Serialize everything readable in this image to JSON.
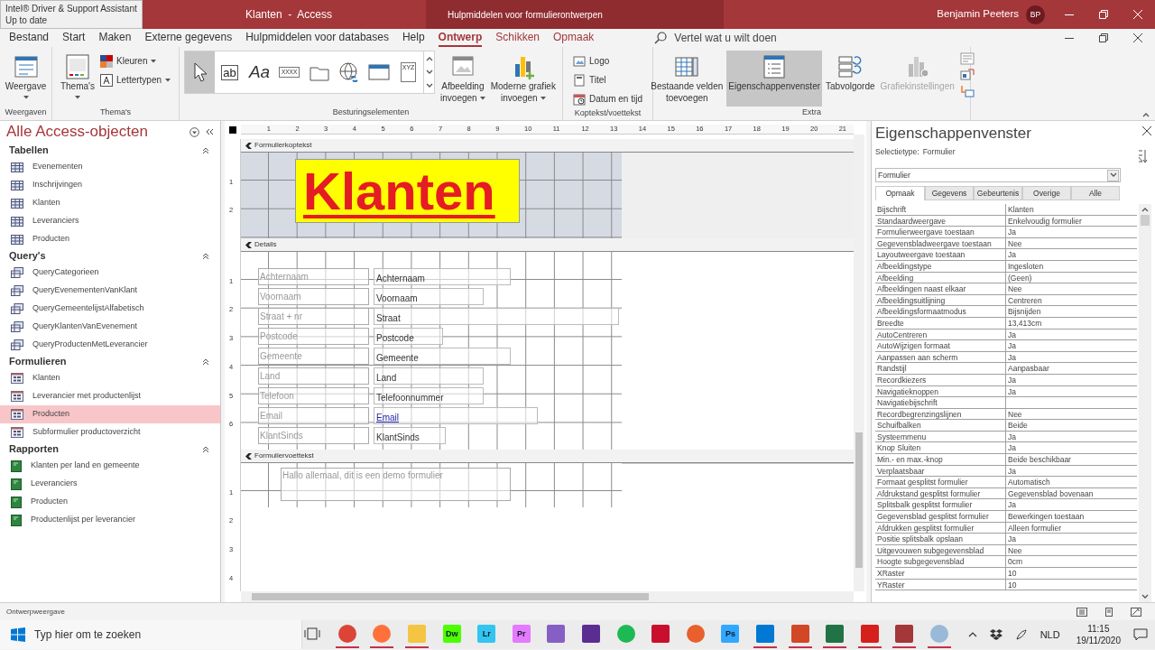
{
  "notification": {
    "title": "Intel® Driver & Support Assistant",
    "status": "Up to date"
  },
  "title_bar": {
    "title": "Klanten  -  Access",
    "context_title": "Hulpmiddelen voor formulierontwerpen",
    "user": "Benjamin Peeters",
    "initials": "BP"
  },
  "menu_tabs": [
    {
      "label": "Bestand",
      "kind": "normal",
      "selected": false
    },
    {
      "label": "Start",
      "kind": "normal",
      "selected": false
    },
    {
      "label": "Maken",
      "kind": "normal",
      "selected": false
    },
    {
      "label": "Externe gegevens",
      "kind": "normal",
      "selected": false
    },
    {
      "label": "Hulpmiddelen voor databases",
      "kind": "normal",
      "selected": false
    },
    {
      "label": "Help",
      "kind": "normal",
      "selected": false
    },
    {
      "label": "Ontwerp",
      "kind": "contextual",
      "selected": true
    },
    {
      "label": "Schikken",
      "kind": "contextual",
      "selected": false
    },
    {
      "label": "Opmaak",
      "kind": "contextual",
      "selected": false
    }
  ],
  "tell_me": {
    "placeholder": "Vertel wat u wilt doen"
  },
  "ribbon": [
    {
      "label": "Weergaven",
      "items": [
        {
          "kind": "large",
          "lines": [
            "Weergave"
          ],
          "dropdown": true,
          "selected": false,
          "disabled": false
        }
      ]
    },
    {
      "label": "Thema's",
      "items": [
        {
          "kind": "large",
          "lines": [
            "Thema's"
          ],
          "dropdown": true,
          "selected": false,
          "disabled": false
        },
        {
          "kind": "small",
          "lines": [
            "Kleuren"
          ],
          "dropdown": true,
          "selected": false,
          "disabled": false
        },
        {
          "kind": "small",
          "lines": [
            "Lettertypen"
          ],
          "dropdown": true,
          "selected": false,
          "disabled": false
        }
      ]
    },
    {
      "label": "Besturingselementen",
      "items": [
        {
          "kind": "gallery",
          "tools": [
            {
              "selected": true
            },
            {
              "glyph": "ab",
              "selected": false
            },
            {
              "glyph": "Aa",
              "selected": false
            },
            {
              "glyph": "XXXX",
              "selected": false
            },
            {
              "selected": false
            },
            {
              "selected": false
            },
            {
              "selected": false
            },
            {
              "glyph": "XYZ",
              "selected": false
            }
          ]
        },
        {
          "kind": "large",
          "lines": [
            "Afbeelding",
            "invoegen"
          ],
          "dropdown": true,
          "selected": false,
          "disabled": false
        },
        {
          "kind": "large",
          "lines": [
            "Moderne grafiek",
            "invoegen"
          ],
          "dropdown": true,
          "selected": false,
          "disabled": false
        }
      ]
    },
    {
      "label": "Koptekst/voettekst",
      "items": [
        {
          "kind": "small",
          "lines": [
            "Logo"
          ],
          "dropdown": false,
          "selected": false,
          "disabled": false
        },
        {
          "kind": "small",
          "lines": [
            "Titel"
          ],
          "dropdown": false,
          "selected": false,
          "disabled": false
        },
        {
          "kind": "small",
          "lines": [
            "Datum en tijd"
          ],
          "dropdown": false,
          "selected": false,
          "disabled": false
        }
      ]
    },
    {
      "label": "Extra",
      "items": [
        {
          "kind": "large",
          "lines": [
            "Bestaande velden",
            "toevoegen"
          ],
          "dropdown": false,
          "selected": false,
          "disabled": false
        },
        {
          "kind": "large",
          "lines": [
            "Eigenschappenvenster"
          ],
          "dropdown": false,
          "selected": true,
          "disabled": false
        },
        {
          "kind": "large",
          "lines": [
            "Tabvolgorde"
          ],
          "dropdown": false,
          "selected": false,
          "disabled": false
        },
        {
          "kind": "large",
          "lines": [
            "Grafiekinstellingen"
          ],
          "dropdown": false,
          "selected": false,
          "disabled": true
        },
        {
          "kind": "iconcolumn"
        }
      ]
    }
  ],
  "navigation": {
    "title": "Alle Access-objecten",
    "groups": [
      {
        "label": "Tabellen",
        "kind": "table",
        "items": [
          {
            "label": "Evenementen",
            "selected": false
          },
          {
            "label": "Inschrijvingen",
            "selected": false
          },
          {
            "label": "Klanten",
            "selected": false
          },
          {
            "label": "Leveranciers",
            "selected": false
          },
          {
            "label": "Producten",
            "selected": false
          }
        ]
      },
      {
        "label": "Query's",
        "kind": "query",
        "items": [
          {
            "label": "QueryCategorieen",
            "selected": false
          },
          {
            "label": "QueryEvenementenVanKlant",
            "selected": false
          },
          {
            "label": "QueryGemeentelijstAlfabetisch",
            "selected": false
          },
          {
            "label": "QueryKlantenVanEvenement",
            "selected": false
          },
          {
            "label": "QueryProductenMetLeverancier",
            "selected": false
          }
        ]
      },
      {
        "label": "Formulieren",
        "kind": "form",
        "items": [
          {
            "label": "Klanten",
            "selected": false
          },
          {
            "label": "Leverancier met productenlijst",
            "selected": false
          },
          {
            "label": "Producten",
            "selected": true
          },
          {
            "label": "Subformulier productoverzicht",
            "selected": false
          }
        ]
      },
      {
        "label": "Rapporten",
        "kind": "report",
        "items": [
          {
            "label": "Klanten per land en gemeente",
            "selected": false
          },
          {
            "label": "Leveranciers",
            "selected": false
          },
          {
            "label": "Producten",
            "selected": false
          },
          {
            "label": "Productenlijst per leverancier",
            "selected": false
          }
        ]
      }
    ]
  },
  "form_design": {
    "ruler": [
      "1",
      "2",
      "3",
      "4",
      "5",
      "6",
      "7",
      "8",
      "9",
      "10",
      "11",
      "12",
      "13",
      "14",
      "15",
      "16",
      "17",
      "18",
      "19",
      "20",
      "21"
    ],
    "sections": [
      {
        "kind": "header",
        "label": "Formulierkoptekst",
        "ruler": [
          "1",
          "2"
        ],
        "title": "Klanten"
      },
      {
        "kind": "detail",
        "label": "Details",
        "ruler": [
          "1",
          "2",
          "3",
          "4",
          "5",
          "6"
        ],
        "fields": [
          {
            "label": "Achternaam",
            "control": "Achternaam",
            "link": false
          },
          {
            "label": "Voornaam",
            "control": "Voornaam",
            "link": false
          },
          {
            "label": "Straat + nr",
            "control": "Straat",
            "link": false
          },
          {
            "label": "Postcode",
            "control": "Postcode",
            "link": false
          },
          {
            "label": "Gemeente",
            "control": "Gemeente",
            "link": false
          },
          {
            "label": "Land",
            "control": "Land",
            "link": false
          },
          {
            "label": "Telefoon",
            "control": "Telefoonnummer",
            "link": false
          },
          {
            "label": "Email",
            "control": "Email",
            "link": true
          },
          {
            "label": "KlantSinds",
            "control": "KlantSinds",
            "link": false
          }
        ]
      },
      {
        "kind": "footer",
        "label": "Formuliervoettekst",
        "ruler": [
          "1",
          "2",
          "3",
          "4"
        ],
        "text": "Hallo allemaal, dit is een demo formulier"
      }
    ]
  },
  "property_sheet": {
    "title": "Eigenschappenvenster",
    "selection_label": "Selectietype:",
    "selection_type": "Formulier",
    "object": "Formulier",
    "tabs": [
      {
        "label": "Opmaak",
        "selected": true
      },
      {
        "label": "Gegevens",
        "selected": false
      },
      {
        "label": "Gebeurtenis",
        "selected": false
      },
      {
        "label": "Overige",
        "selected": false
      },
      {
        "label": "Alle",
        "selected": false
      }
    ],
    "rows": [
      {
        "name": "Bijschrift",
        "value": "Klanten"
      },
      {
        "name": "Standaardweergave",
        "value": "Enkelvoudig formulier"
      },
      {
        "name": "Formulierweergave toestaan",
        "value": "Ja"
      },
      {
        "name": "Gegevensbladweergave toestaan",
        "value": "Nee"
      },
      {
        "name": "Layoutweergave toestaan",
        "value": "Ja"
      },
      {
        "name": "Afbeeldingstype",
        "value": "Ingesloten"
      },
      {
        "name": "Afbeelding",
        "value": "(Geen)"
      },
      {
        "name": "Afbeeldingen naast elkaar",
        "value": "Nee"
      },
      {
        "name": "Afbeeldingsuitlijning",
        "value": "Centreren"
      },
      {
        "name": "Afbeeldingsformaatmodus",
        "value": "Bijsnijden"
      },
      {
        "name": "Breedte",
        "value": "13,413cm"
      },
      {
        "name": "AutoCentreren",
        "value": "Ja"
      },
      {
        "name": "AutoWijzigen formaat",
        "value": "Ja"
      },
      {
        "name": "Aanpassen aan scherm",
        "value": "Ja"
      },
      {
        "name": "Randstijl",
        "value": "Aanpasbaar"
      },
      {
        "name": "Recordkiezers",
        "value": "Ja"
      },
      {
        "name": "Navigatieknoppen",
        "value": "Ja"
      },
      {
        "name": "Navigatiebijschrift"
      },
      {
        "name": "Recordbegrenzingslijnen",
        "value": "Nee"
      },
      {
        "name": "Schuifbalken",
        "value": "Beide"
      },
      {
        "name": "Systeemmenu",
        "value": "Ja"
      },
      {
        "name": "Knop Sluiten",
        "value": "Ja"
      },
      {
        "name": "Min.- en max.-knop",
        "value": "Beide beschikbaar"
      },
      {
        "name": "Verplaatsbaar",
        "value": "Ja"
      },
      {
        "name": "Formaat gesplitst formulier",
        "value": "Automatisch"
      },
      {
        "name": "Afdrukstand gesplitst formulier",
        "value": "Gegevensblad bovenaan"
      },
      {
        "name": "Splitsbalk gesplitst formulier",
        "value": "Ja"
      },
      {
        "name": "Gegevensblad gesplitst formulier",
        "value": "Bewerkingen toestaan"
      },
      {
        "name": "Afdrukken gesplitst formulier",
        "value": "Alleen formulier"
      },
      {
        "name": "Positie splitsbalk opslaan",
        "value": "Ja"
      },
      {
        "name": "Uitgevouwen subgegevensblad",
        "value": "Nee"
      },
      {
        "name": "Hoogte subgegevensblad",
        "value": "0cm"
      },
      {
        "name": "XRaster",
        "value": "10"
      },
      {
        "name": "YRaster",
        "value": "10"
      }
    ]
  },
  "status_bar": {
    "text": "Ontwerpweergave"
  },
  "taskbar": {
    "search": {
      "placeholder": "Typ hier om te zoeken"
    },
    "apps": [
      {
        "kind": "taskview",
        "running": false
      },
      {
        "kind": "circle",
        "color": "#db4437",
        "running": true
      },
      {
        "kind": "circle",
        "color": "#ff7139",
        "running": true
      },
      {
        "kind": "square",
        "color": "#f4c542",
        "running": true
      },
      {
        "kind": "square",
        "color": "#4cff00",
        "glyph": "Dw",
        "running": false
      },
      {
        "kind": "square",
        "color": "#31c5f0",
        "glyph": "Lr",
        "running": false
      },
      {
        "kind": "square",
        "color": "#e579ff",
        "glyph": "Pr",
        "running": false
      },
      {
        "kind": "square",
        "color": "#865fc5",
        "running": false
      },
      {
        "kind": "square",
        "color": "#5c2d91",
        "running": false
      },
      {
        "kind": "circle",
        "color": "#1db954",
        "running": false
      },
      {
        "kind": "square",
        "color": "#c8102e",
        "running": false
      },
      {
        "kind": "circle",
        "color": "#e8602c",
        "running": false
      },
      {
        "kind": "square",
        "color": "#31a8ff",
        "glyph": "Ps",
        "running": false
      },
      {
        "kind": "square",
        "color": "#0078d4",
        "running": true
      },
      {
        "kind": "square",
        "color": "#d24726",
        "running": true
      },
      {
        "kind": "square",
        "color": "#217346",
        "running": true
      },
      {
        "kind": "square",
        "color": "#d5201c",
        "running": true
      },
      {
        "kind": "square",
        "color": "#a4373a",
        "running": true
      },
      {
        "kind": "circle",
        "color": "#9ab8d8",
        "running": true
      }
    ],
    "language": "NLD",
    "time": "11:15",
    "date": "19/11/2020"
  }
}
